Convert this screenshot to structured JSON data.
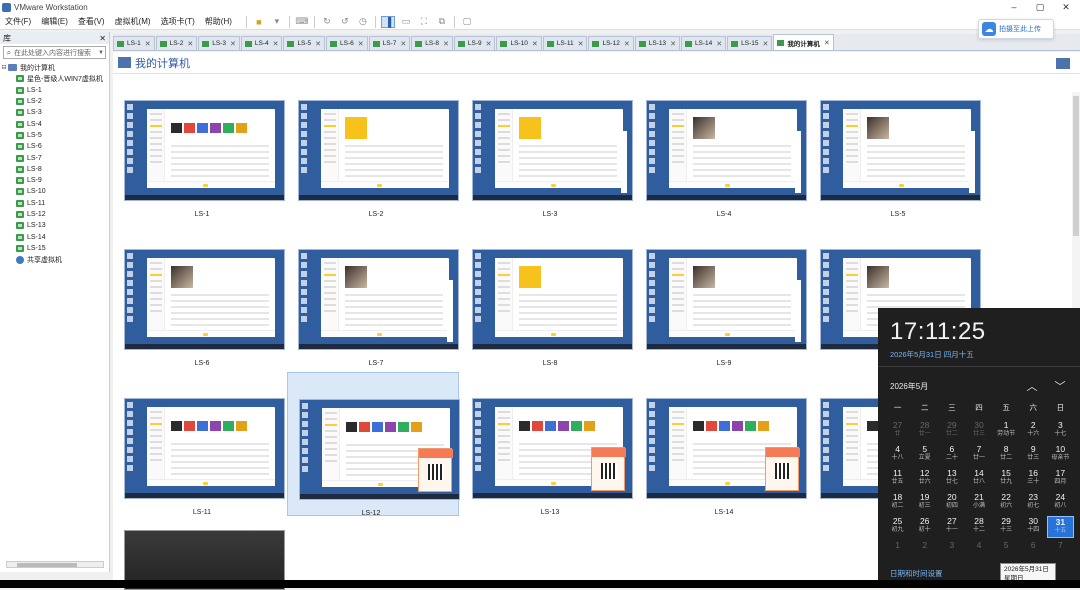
{
  "window": {
    "title": "VMware Workstation",
    "controls": [
      "–",
      "▢",
      "✕"
    ]
  },
  "menu": [
    "文件(F)",
    "编辑(E)",
    "查看(V)",
    "虚拟机(M)",
    "选项卡(T)",
    "帮助(H)"
  ],
  "sidebar": {
    "header": "库",
    "close": "✕",
    "search_placeholder": "在此处键入内容进行搜索",
    "root": "我的计算机",
    "items": [
      "星色-晋级人WIN7虚拟机",
      "LS-1",
      "LS-2",
      "LS-3",
      "LS-4",
      "LS-5",
      "LS-6",
      "LS-7",
      "LS-8",
      "LS-9",
      "LS-10",
      "LS-11",
      "LS-12",
      "LS-13",
      "LS-14",
      "LS-15"
    ],
    "shared": "共享虚拟机"
  },
  "tabs": [
    "LS-1",
    "LS-2",
    "LS-3",
    "LS-4",
    "LS-5",
    "LS-6",
    "LS-7",
    "LS-8",
    "LS-9",
    "LS-10",
    "LS-11",
    "LS-12",
    "LS-13",
    "LS-14",
    "LS-15",
    "我的计算机"
  ],
  "active_tab": "我的计算机",
  "cloud_button": "拍摄至此上传",
  "page_title": "我的计算机",
  "vms": [
    {
      "name": "LS-1",
      "variant": "tiles"
    },
    {
      "name": "LS-2",
      "variant": "yellow"
    },
    {
      "name": "LS-3",
      "variant": "yellow"
    },
    {
      "name": "LS-4",
      "variant": "album"
    },
    {
      "name": "LS-5",
      "variant": "album"
    },
    {
      "name": "LS-6",
      "variant": "album"
    },
    {
      "name": "LS-7",
      "variant": "album"
    },
    {
      "name": "LS-8",
      "variant": "yellow"
    },
    {
      "name": "LS-9",
      "variant": "album"
    },
    {
      "name": "LS-10",
      "variant": "album"
    },
    {
      "name": "LS-11",
      "variant": "tiles"
    },
    {
      "name": "LS-12",
      "variant": "promo"
    },
    {
      "name": "LS-13",
      "variant": "promo"
    },
    {
      "name": "LS-14",
      "variant": "promo"
    },
    {
      "name": "LS-15",
      "variant": "tiles"
    }
  ],
  "selected_vm": "LS-12",
  "clock": {
    "time": "17:11:25",
    "date": "2026年5月31日 四月十五",
    "month_label": "2026年5月",
    "weekdays": [
      "一",
      "二",
      "三",
      "四",
      "五",
      "六",
      "日"
    ],
    "weeks": [
      [
        [
          "27",
          "廿"
        ],
        [
          "28",
          "廿一"
        ],
        [
          "29",
          "廿二"
        ],
        [
          "30",
          "廿三"
        ],
        [
          "1",
          "劳动节"
        ],
        [
          "2",
          "十六"
        ],
        [
          "3",
          "十七"
        ]
      ],
      [
        [
          "4",
          "十八"
        ],
        [
          "5",
          "立夏"
        ],
        [
          "6",
          "二十"
        ],
        [
          "7",
          "廿一"
        ],
        [
          "8",
          "廿二"
        ],
        [
          "9",
          "廿三"
        ],
        [
          "10",
          "母亲节"
        ]
      ],
      [
        [
          "11",
          "廿五"
        ],
        [
          "12",
          "廿六"
        ],
        [
          "13",
          "廿七"
        ],
        [
          "14",
          "廿八"
        ],
        [
          "15",
          "廿九"
        ],
        [
          "16",
          "三十"
        ],
        [
          "17",
          "四月"
        ]
      ],
      [
        [
          "18",
          "初二"
        ],
        [
          "19",
          "初三"
        ],
        [
          "20",
          "初四"
        ],
        [
          "21",
          "小满"
        ],
        [
          "22",
          "初六"
        ],
        [
          "23",
          "初七"
        ],
        [
          "24",
          "初八"
        ]
      ],
      [
        [
          "25",
          "初九"
        ],
        [
          "26",
          "初十"
        ],
        [
          "27",
          "十一"
        ],
        [
          "28",
          "十二"
        ],
        [
          "29",
          "十三"
        ],
        [
          "30",
          "十四"
        ],
        [
          "31",
          "十五"
        ]
      ],
      [
        [
          "1",
          ""
        ],
        [
          "2",
          ""
        ],
        [
          "3",
          ""
        ],
        [
          "4",
          ""
        ],
        [
          "5",
          ""
        ],
        [
          "6",
          ""
        ],
        [
          "7",
          ""
        ]
      ]
    ],
    "today": "31",
    "settings_link": "日期和时间设置",
    "tooltip_date": "2026年5月31日",
    "tooltip_weekday": "星期日"
  },
  "colors": {
    "accent": "#2773d8",
    "desktop": "#2f5d9e",
    "title_blue": "#2e5aa4"
  }
}
